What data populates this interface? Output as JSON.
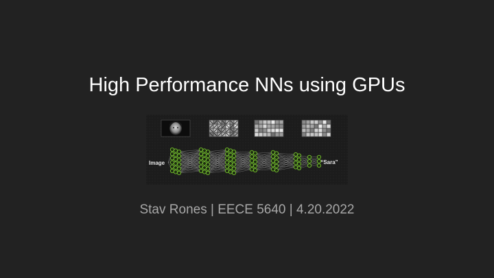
{
  "slide": {
    "title": "High Performance NNs using GPUs",
    "subtitle": "Stav Rones | EECE 5640 | 4.20.2022",
    "colors": {
      "background": "#222222",
      "title": "#ffffff",
      "subtitle": "#a8a8a8",
      "node": "#6fb82b",
      "figure_background": "#1a1a1a"
    }
  },
  "figure": {
    "input_label": "Image",
    "output_label": "“Sara”"
  }
}
